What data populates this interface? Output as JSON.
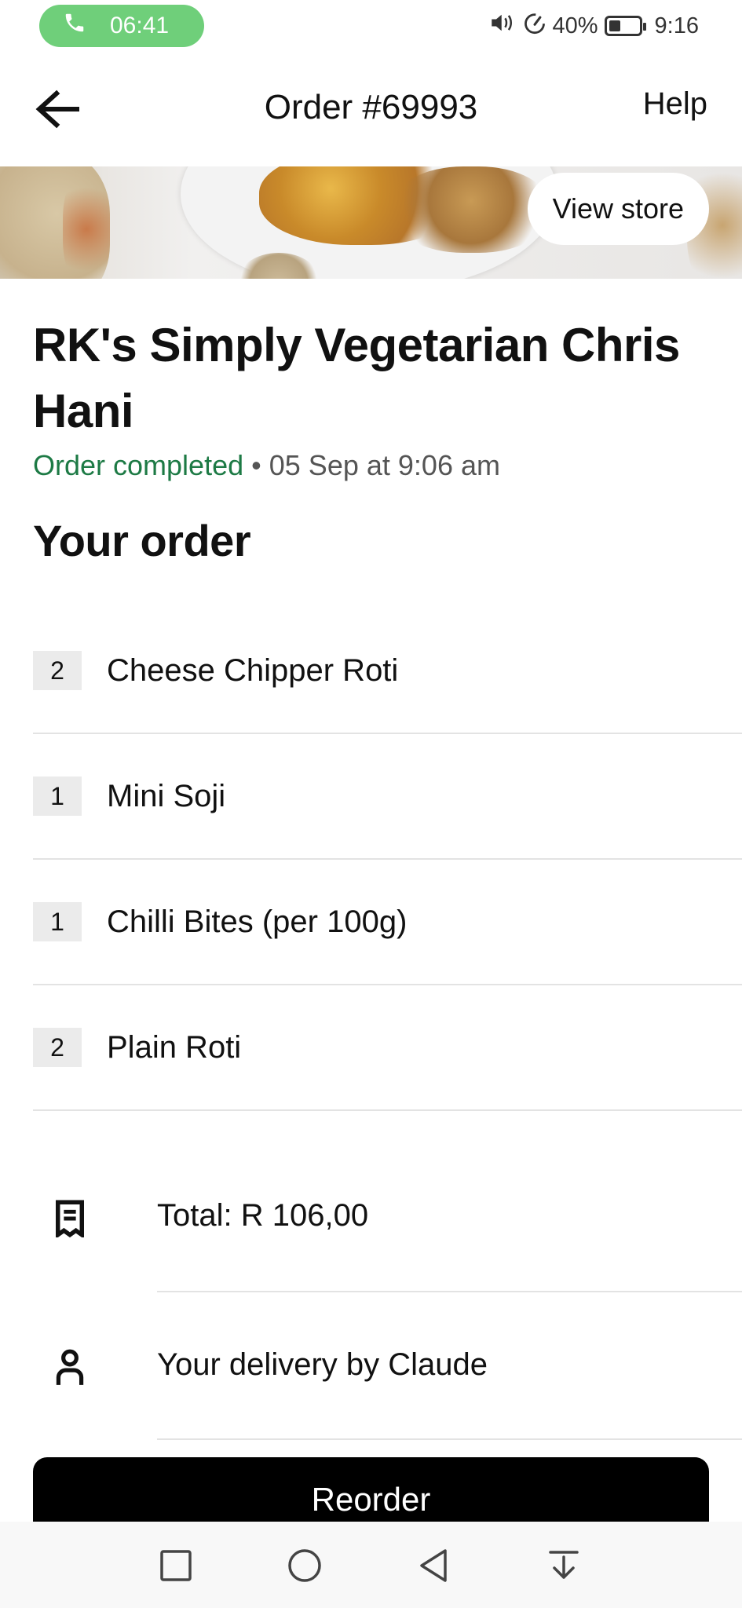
{
  "status_bar": {
    "call_time": "06:41",
    "battery_percent": "40%",
    "battery_level": 0.4,
    "clock": "9:16",
    "icons": [
      "phone-icon",
      "volume-icon",
      "data-speed-icon",
      "battery-icon"
    ]
  },
  "header": {
    "back_icon": "arrow-left-icon",
    "title": "Order #69993",
    "help_label": "Help"
  },
  "banner": {
    "view_store_label": "View store"
  },
  "store": {
    "name": "RK's Simply Vegetarian Chris Hani",
    "status": "Order completed",
    "separator": "•",
    "datetime": "05 Sep at 9:06 am"
  },
  "order": {
    "section_title": "Your order",
    "items": [
      {
        "qty": "2",
        "name": "Cheese Chipper Roti"
      },
      {
        "qty": "1",
        "name": "Mini Soji"
      },
      {
        "qty": "1",
        "name": "Chilli Bites (per 100g)"
      },
      {
        "qty": "2",
        "name": "Plain Roti"
      }
    ]
  },
  "details": {
    "total_icon": "receipt-icon",
    "total_text": "Total: R 106,00",
    "delivery_icon": "person-icon",
    "delivery_text": "Your delivery by Claude"
  },
  "actions": {
    "reorder_label": "Reorder"
  },
  "nav_bar": {
    "icons": [
      "square-recents-icon",
      "circle-home-icon",
      "triangle-back-icon",
      "notification-pull-icon"
    ]
  },
  "colors": {
    "call_pill": "#6fcf7a",
    "status_green": "#1d7a45",
    "button_black": "#000000",
    "qty_badge_bg": "#ebebeb"
  }
}
